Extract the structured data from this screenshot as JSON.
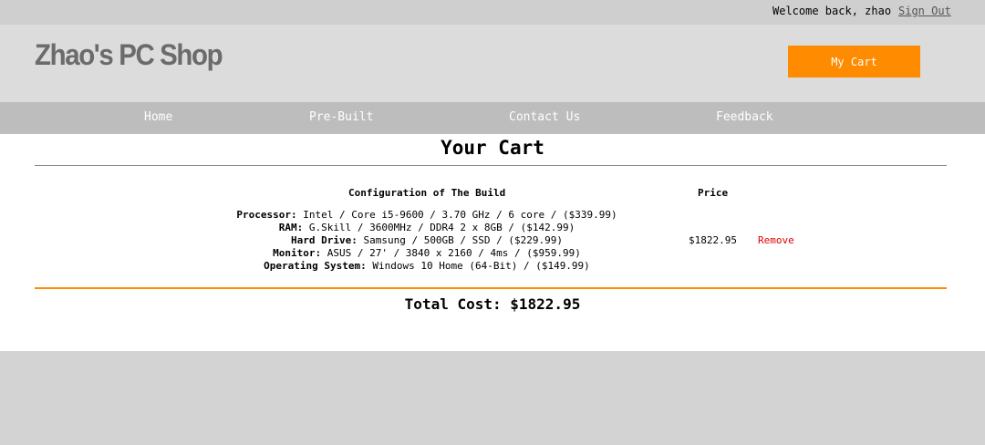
{
  "topbar": {
    "welcome": "Welcome back, zhao",
    "sign_out": "Sign Out"
  },
  "header": {
    "logo": "Zhao's PC Shop",
    "cart_button": "My Cart"
  },
  "nav": {
    "items": [
      "Home",
      "Pre-Built",
      "Contact Us",
      "Feedback"
    ]
  },
  "cart": {
    "title": "Your Cart",
    "col_config": "Configuration of The Build",
    "col_price": "Price",
    "rows": [
      {
        "label": "Processor:",
        "value": " Intel / Core i5-9600 / 3.70 GHz / 6 core / ($339.99)"
      },
      {
        "label": "RAM:",
        "value": " G.Skill / 3600MHz / DDR4 2 x 8GB / ($142.99)"
      },
      {
        "label": "Hard Drive:",
        "value": " Samsung / 500GB / SSD / ($229.99)"
      },
      {
        "label": "Monitor:",
        "value": " ASUS / 27' / 3840 x 2160 / 4ms / ($959.99)"
      },
      {
        "label": "Operating System:",
        "value": " Windows 10 Home (64-Bit) / ($149.99)"
      }
    ],
    "price": "$1822.95",
    "remove": "Remove",
    "total": "Total Cost: $1822.95"
  },
  "colors": {
    "accent": "#ff8c00",
    "remove": "#e00000"
  }
}
